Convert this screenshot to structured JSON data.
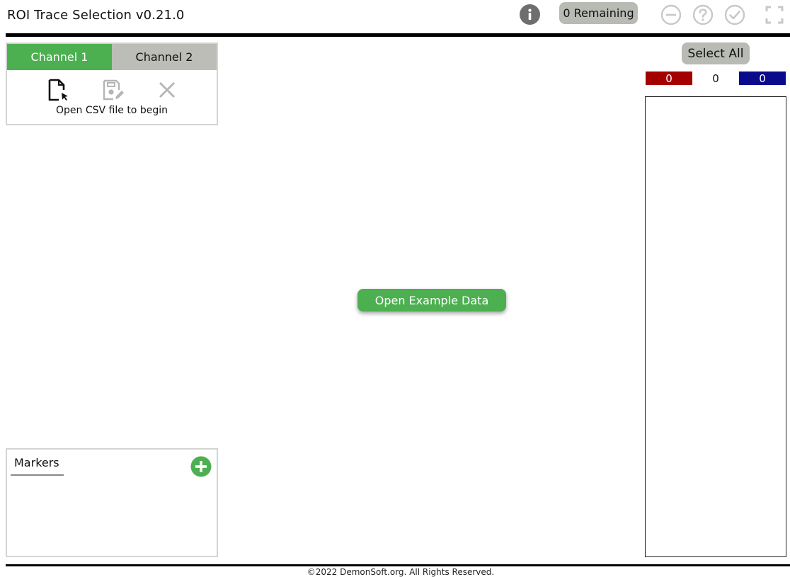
{
  "header": {
    "title": "ROI Trace Selection v0.21.0",
    "remaining_label": "0 Remaining",
    "icons": [
      "info-icon",
      "minus-circle-icon",
      "question-circle-icon",
      "check-circle-icon",
      "fullscreen-icon"
    ]
  },
  "channels": {
    "tabs": [
      {
        "label": "Channel 1",
        "active": true
      },
      {
        "label": "Channel 2",
        "active": false
      }
    ],
    "file_icons": [
      "open-file-icon",
      "save-file-icon",
      "close-icon"
    ],
    "hint": "Open CSV file to begin"
  },
  "markers": {
    "title": "Markers",
    "icon": "add-circle-icon"
  },
  "main": {
    "example_button_label": "Open Example Data"
  },
  "selection": {
    "select_all_label": "Select All",
    "counts": {
      "rejected": "0",
      "unassigned": "0",
      "accepted": "0"
    }
  },
  "footer": {
    "copyright": "©2022 DemonSoft.org. All Rights Reserved."
  },
  "colors": {
    "accent_green": "#4caf50",
    "tab_gray": "#bcbdb7",
    "rejected_red": "#a50000",
    "accepted_blue": "#0a0a8c"
  }
}
